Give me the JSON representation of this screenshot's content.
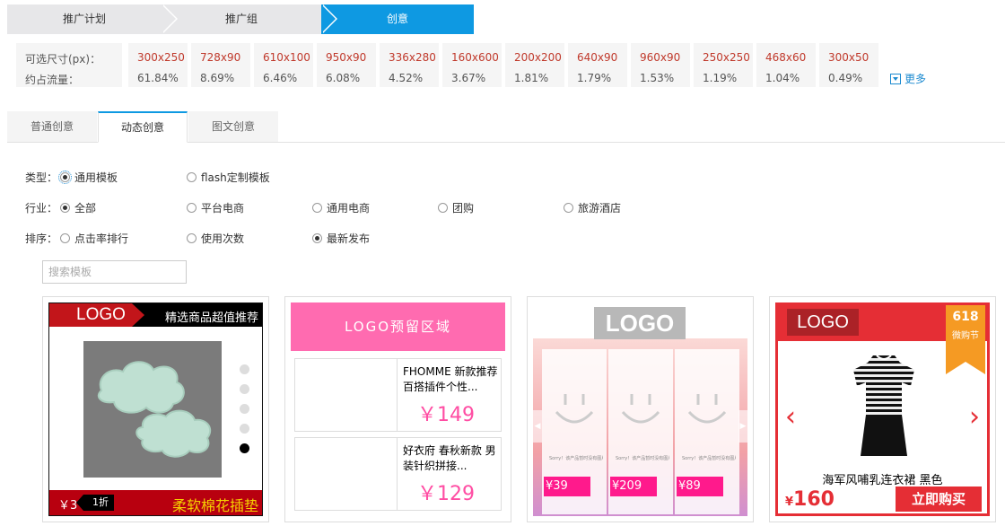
{
  "steps": [
    "推广计划",
    "推广组",
    "创意"
  ],
  "sizes": {
    "label_size": "可选尺寸(px)：",
    "label_traffic": "约占流量：",
    "items": [
      {
        "size": "300x250",
        "pct": "61.84%"
      },
      {
        "size": "728x90",
        "pct": "8.69%"
      },
      {
        "size": "610x100",
        "pct": "6.46%"
      },
      {
        "size": "950x90",
        "pct": "6.08%"
      },
      {
        "size": "336x280",
        "pct": "4.52%"
      },
      {
        "size": "160x600",
        "pct": "3.67%"
      },
      {
        "size": "200x200",
        "pct": "1.81%"
      },
      {
        "size": "640x90",
        "pct": "1.79%"
      },
      {
        "size": "960x90",
        "pct": "1.53%"
      },
      {
        "size": "250x250",
        "pct": "1.19%"
      },
      {
        "size": "468x60",
        "pct": "1.04%"
      },
      {
        "size": "300x50",
        "pct": "0.49%"
      }
    ],
    "more": "更多"
  },
  "tabs": [
    "普通创意",
    "动态创意",
    "图文创意"
  ],
  "filters": {
    "type": {
      "label": "类型：",
      "options": [
        "通用模板",
        "flash定制模板"
      ]
    },
    "industry": {
      "label": "行业：",
      "options": [
        "全部",
        "平台电商",
        "通用电商",
        "团购",
        "旅游酒店"
      ]
    },
    "sort": {
      "label": "排序：",
      "options": [
        "点击率排行",
        "使用次数",
        "最新发布"
      ]
    }
  },
  "search": {
    "placeholder": "搜索模板"
  },
  "cards": {
    "c1": {
      "logo": "LOGO",
      "slogan": "精选商品超值推荐",
      "price": "￥3",
      "discount": "1折",
      "name": "柔软棉花插垫"
    },
    "c2": {
      "banner": "LOGO预留区域",
      "item1_title": "FHOMME 新款推荐 百搭插件个性...",
      "item1_price": "￥149",
      "item2_title": "好衣府 春秋新款 男装针织拼接...",
      "item2_price": "￥129"
    },
    "c3": {
      "logo": "LOGO",
      "tiny": "Sorry！该产品暂时没有图片。",
      "prices": [
        "¥39",
        "¥209",
        "¥89"
      ]
    },
    "c4": {
      "logo": "LOGO",
      "ribbon_num": "618",
      "ribbon_text": "微购节",
      "name": "海军风哺乳连衣裙 黑色",
      "price_symbol": "¥",
      "price": "160",
      "buy": "立即购买"
    }
  },
  "colors": {
    "accent_blue": "#0e99e2",
    "brand_red": "#e52e35",
    "pink": "#ff6bb0"
  }
}
